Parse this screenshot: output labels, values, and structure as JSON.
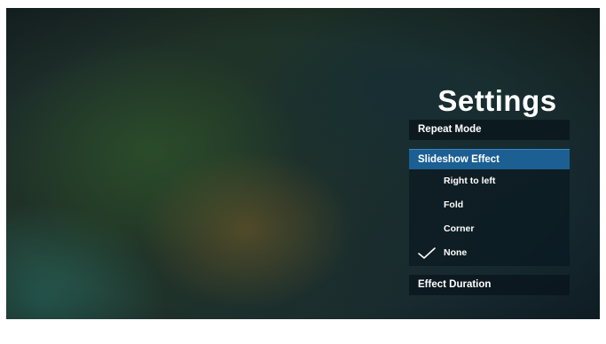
{
  "page": {
    "title": "Settings"
  },
  "menu": {
    "repeat_mode": "Repeat Mode",
    "slideshow_effect": {
      "label": "Slideshow Effect",
      "options": [
        "Right to left",
        "Fold",
        "Corner",
        "None"
      ],
      "selected": "None"
    },
    "effect_duration": "Effect Duration"
  },
  "colors": {
    "highlight": "#1b5f93",
    "text": "#ffffff",
    "row_background": "#08141a"
  },
  "icons": {
    "selected_marker": "checkmark-icon"
  }
}
